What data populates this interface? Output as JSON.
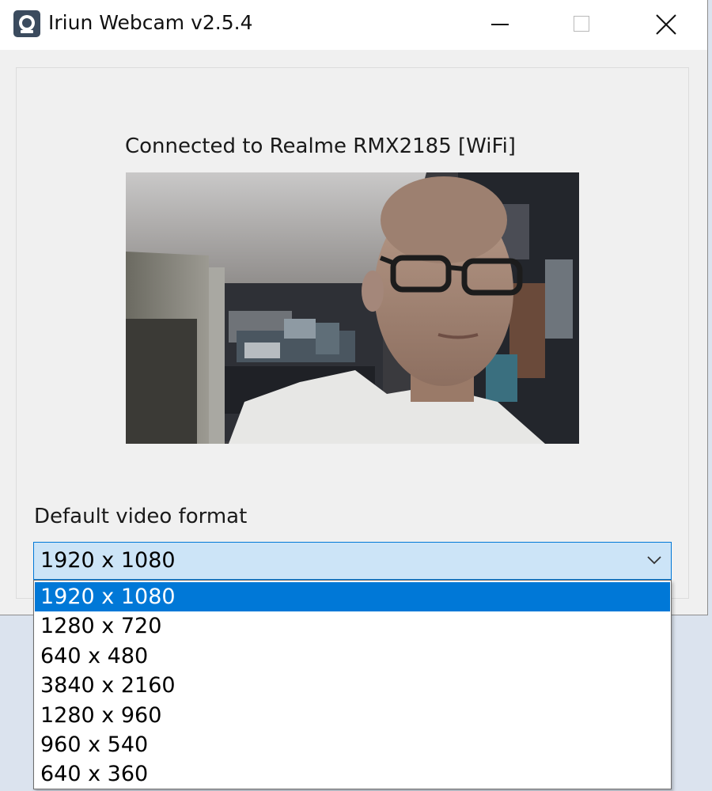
{
  "window": {
    "title": "Iriun Webcam v2.5.4",
    "icon": "iriun-webcam-icon",
    "controls": [
      "minimize-icon",
      "maximize-icon",
      "close-icon"
    ]
  },
  "status": {
    "connected_text": "Connected to Realme RMX2185 [WiFi]"
  },
  "preview": {
    "kind": "live-camera-preview"
  },
  "format": {
    "label": "Default video format",
    "selected": "1920 x 1080",
    "options": [
      "1920 x 1080",
      "1280 x 720",
      "640 x 480",
      "3840 x 2160",
      "1280 x 960",
      "960 x 540",
      "640 x 360"
    ]
  },
  "colors": {
    "accent": "#0078d7",
    "combo_background": "#cce4f7",
    "dialog_background": "#f0f0f0",
    "desktop": "#dbe3ee"
  }
}
